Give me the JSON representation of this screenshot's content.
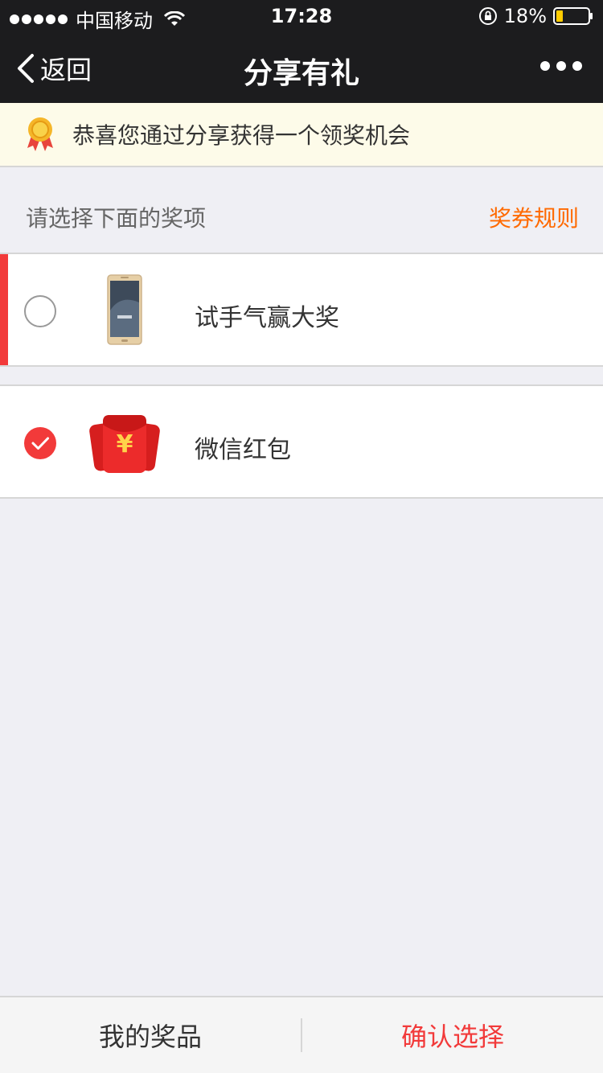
{
  "status_bar": {
    "carrier": "中国移动",
    "time": "17:28",
    "battery": "18%"
  },
  "nav": {
    "back_label": "返回",
    "title": "分享有礼"
  },
  "notice": {
    "text": "恭喜您通过分享获得一个领奖机会"
  },
  "section": {
    "label": "请选择下面的奖项",
    "rules_link": "奖券规则"
  },
  "options": [
    {
      "label": "试手气赢大奖",
      "selected": false,
      "icon": "phone-icon"
    },
    {
      "label": "微信红包",
      "selected": true,
      "icon": "red-envelope-icon"
    }
  ],
  "bottom": {
    "my_prizes": "我的奖品",
    "confirm": "确认选择"
  },
  "colors": {
    "accent": "#f23a3a",
    "link": "#ff6a00",
    "bar_bg": "#1c1c1e",
    "notice_bg": "#fdfbe9"
  }
}
